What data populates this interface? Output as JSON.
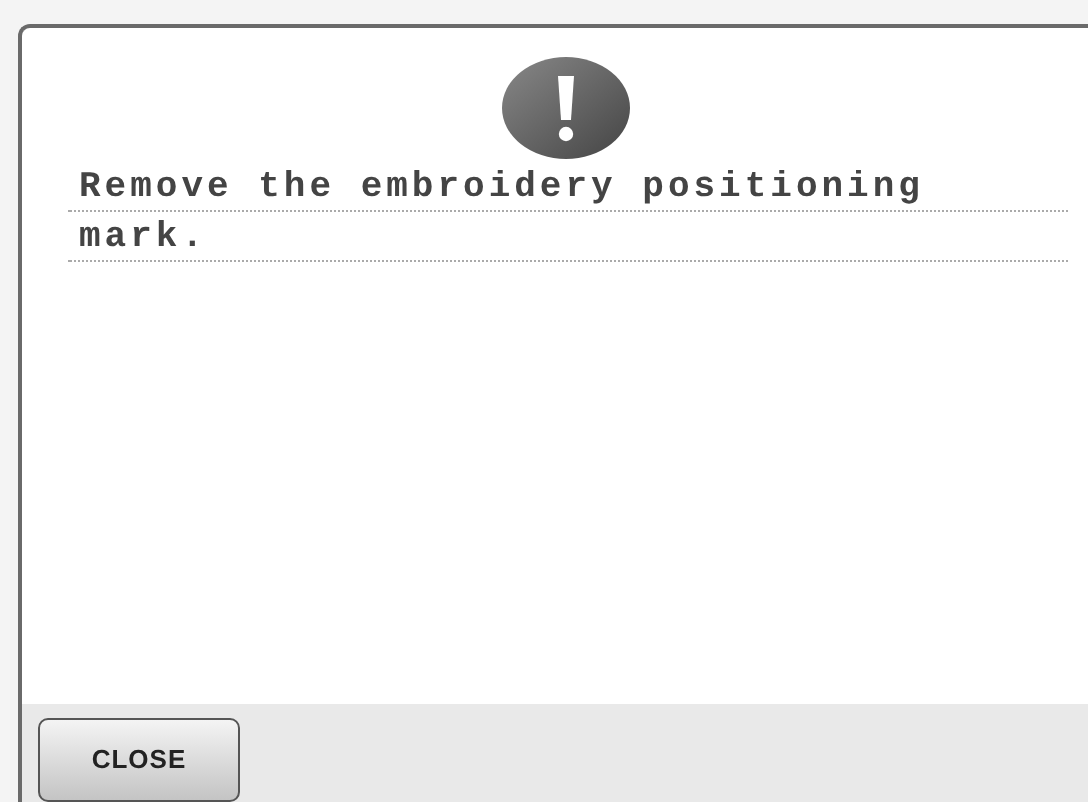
{
  "dialog": {
    "message": "Remove the embroidery positioning mark.",
    "buttons": [
      {
        "label": "CLOSE"
      }
    ]
  }
}
